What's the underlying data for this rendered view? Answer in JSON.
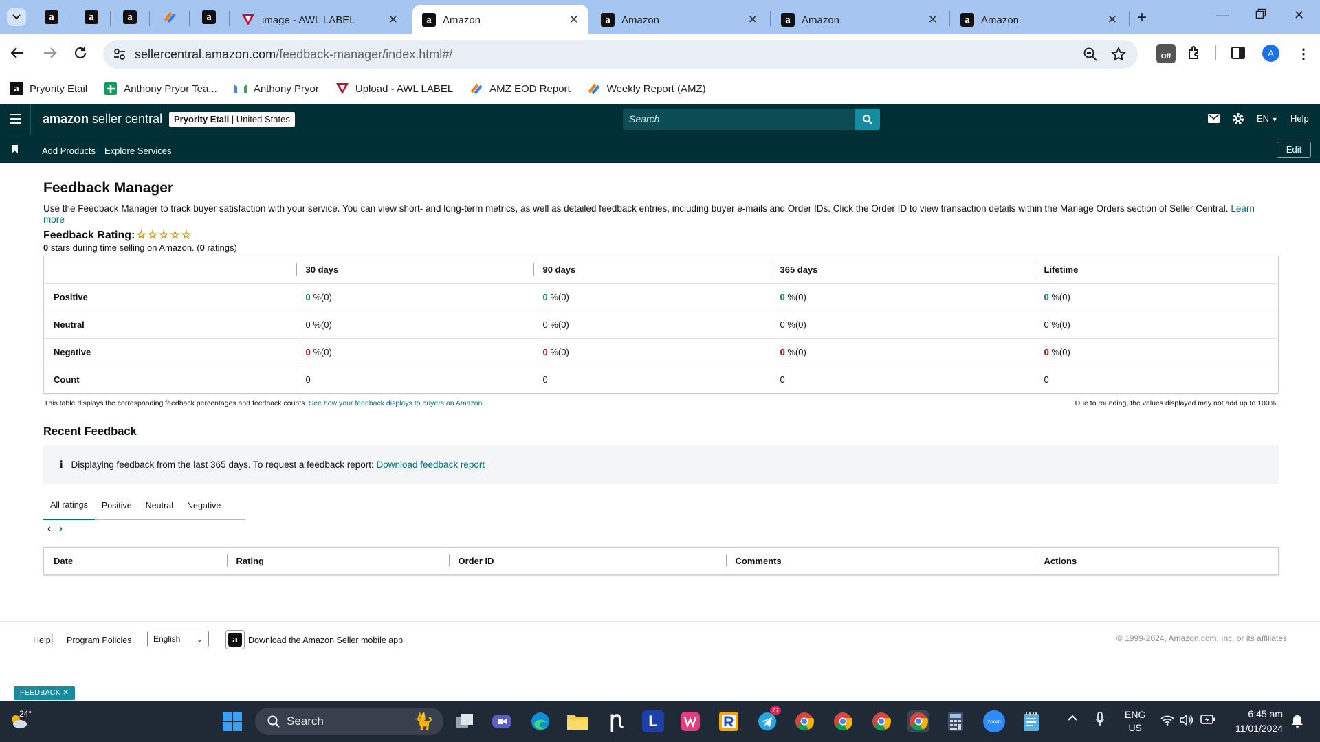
{
  "browser": {
    "tabs": [
      {
        "title": "image - AWL LABEL"
      },
      {
        "title": "Amazon"
      },
      {
        "title": "Amazon"
      },
      {
        "title": "Amazon"
      },
      {
        "title": "Amazon"
      }
    ],
    "url_host": "sellercentral.amazon.com",
    "url_path": "/feedback-manager/index.html#/",
    "profile_initial": "A",
    "extension_badge": "Off",
    "bookmarks": [
      {
        "label": "Pryority Etail"
      },
      {
        "label": "Anthony Pryor Tea..."
      },
      {
        "label": "Anthony Pryor"
      },
      {
        "label": "Upload - AWL LABEL"
      },
      {
        "label": "AMZ EOD Report"
      },
      {
        "label": "Weekly Report (AMZ)"
      }
    ]
  },
  "header": {
    "logo_bold": "amazon",
    "logo_rest": " seller central",
    "account_name": "Pryority Etail",
    "account_region": " | United States",
    "search_placeholder": "Search",
    "language": "EN",
    "help": "Help"
  },
  "nav": {
    "links": [
      "Add Products",
      "Explore Services"
    ],
    "edit": "Edit"
  },
  "page": {
    "title": "Feedback Manager",
    "description": "Use the Feedback Manager to track buyer satisfaction with your service. You can view short- and long-term metrics, as well as detailed feedback entries, including buyer e-mails and Order IDs. Click the Order ID to view transaction details within the Manage Orders section of Seller Central.",
    "learn_more": "Learn more",
    "rating_label": "Feedback Rating:",
    "rating_stars": 0,
    "rating_summary_value": "0",
    "rating_summary_text": " stars during time selling on Amazon. (",
    "rating_count": "0",
    "rating_count_suffix": " ratings)"
  },
  "feedback_table": {
    "columns": [
      "",
      "30 days",
      "90 days",
      "365 days",
      "Lifetime"
    ],
    "rows": [
      {
        "label": "Positive",
        "cells": [
          {
            "v": "0",
            "s": " %(0)"
          },
          {
            "v": "0",
            "s": " %(0)"
          },
          {
            "v": "0",
            "s": " %(0)"
          },
          {
            "v": "0",
            "s": " %(0)"
          }
        ]
      },
      {
        "label": "Neutral",
        "cells": [
          {
            "v": "0",
            "s": " %(0)"
          },
          {
            "v": "0",
            "s": " %(0)"
          },
          {
            "v": "0",
            "s": " %(0)"
          },
          {
            "v": "0",
            "s": " %(0)"
          }
        ]
      },
      {
        "label": "Negative",
        "cells": [
          {
            "v": "0",
            "s": " %(0)"
          },
          {
            "v": "0",
            "s": " %(0)"
          },
          {
            "v": "0",
            "s": " %(0)"
          },
          {
            "v": "0",
            "s": " %(0)"
          }
        ]
      },
      {
        "label": "Count",
        "cells": [
          {
            "v": "0",
            "s": ""
          },
          {
            "v": "0",
            "s": ""
          },
          {
            "v": "0",
            "s": ""
          },
          {
            "v": "0",
            "s": ""
          }
        ]
      }
    ],
    "note_left": "This table displays the corresponding feedback percentages and feedback counts.",
    "note_link": "See how your feedback displays to buyers on Amazon.",
    "note_right": "Due to rounding, the values displayed may not add up to 100%."
  },
  "recent": {
    "title": "Recent Feedback",
    "info_text": "Displaying feedback from the last 365 days. To request a feedback report:",
    "info_link": "Download feedback report",
    "tabs": [
      "All ratings",
      "Positive",
      "Neutral",
      "Negative"
    ],
    "selected_tab": "All ratings",
    "columns": [
      "Date",
      "Rating",
      "Order ID",
      "Comments",
      "Actions"
    ]
  },
  "footer": {
    "help": "Help",
    "policies": "Program Policies",
    "language": "English",
    "app_text": "Download the Amazon Seller mobile app",
    "copyright": "© 1999-2024, Amazon.com, Inc. or its affiliates",
    "feedback_tag": "FEEDBACK ✕"
  },
  "taskbar": {
    "weather_temp": "24°",
    "search": "Search",
    "telegram_badge": "77",
    "lang_top": "ENG",
    "lang_bottom": "US",
    "time": "6:45 am",
    "date": "11/01/2024"
  },
  "colors": {
    "header_bg": "#002f36",
    "link": "#007185",
    "positive": "#067d62",
    "negative": "#c40000",
    "star": "#c98b00"
  }
}
